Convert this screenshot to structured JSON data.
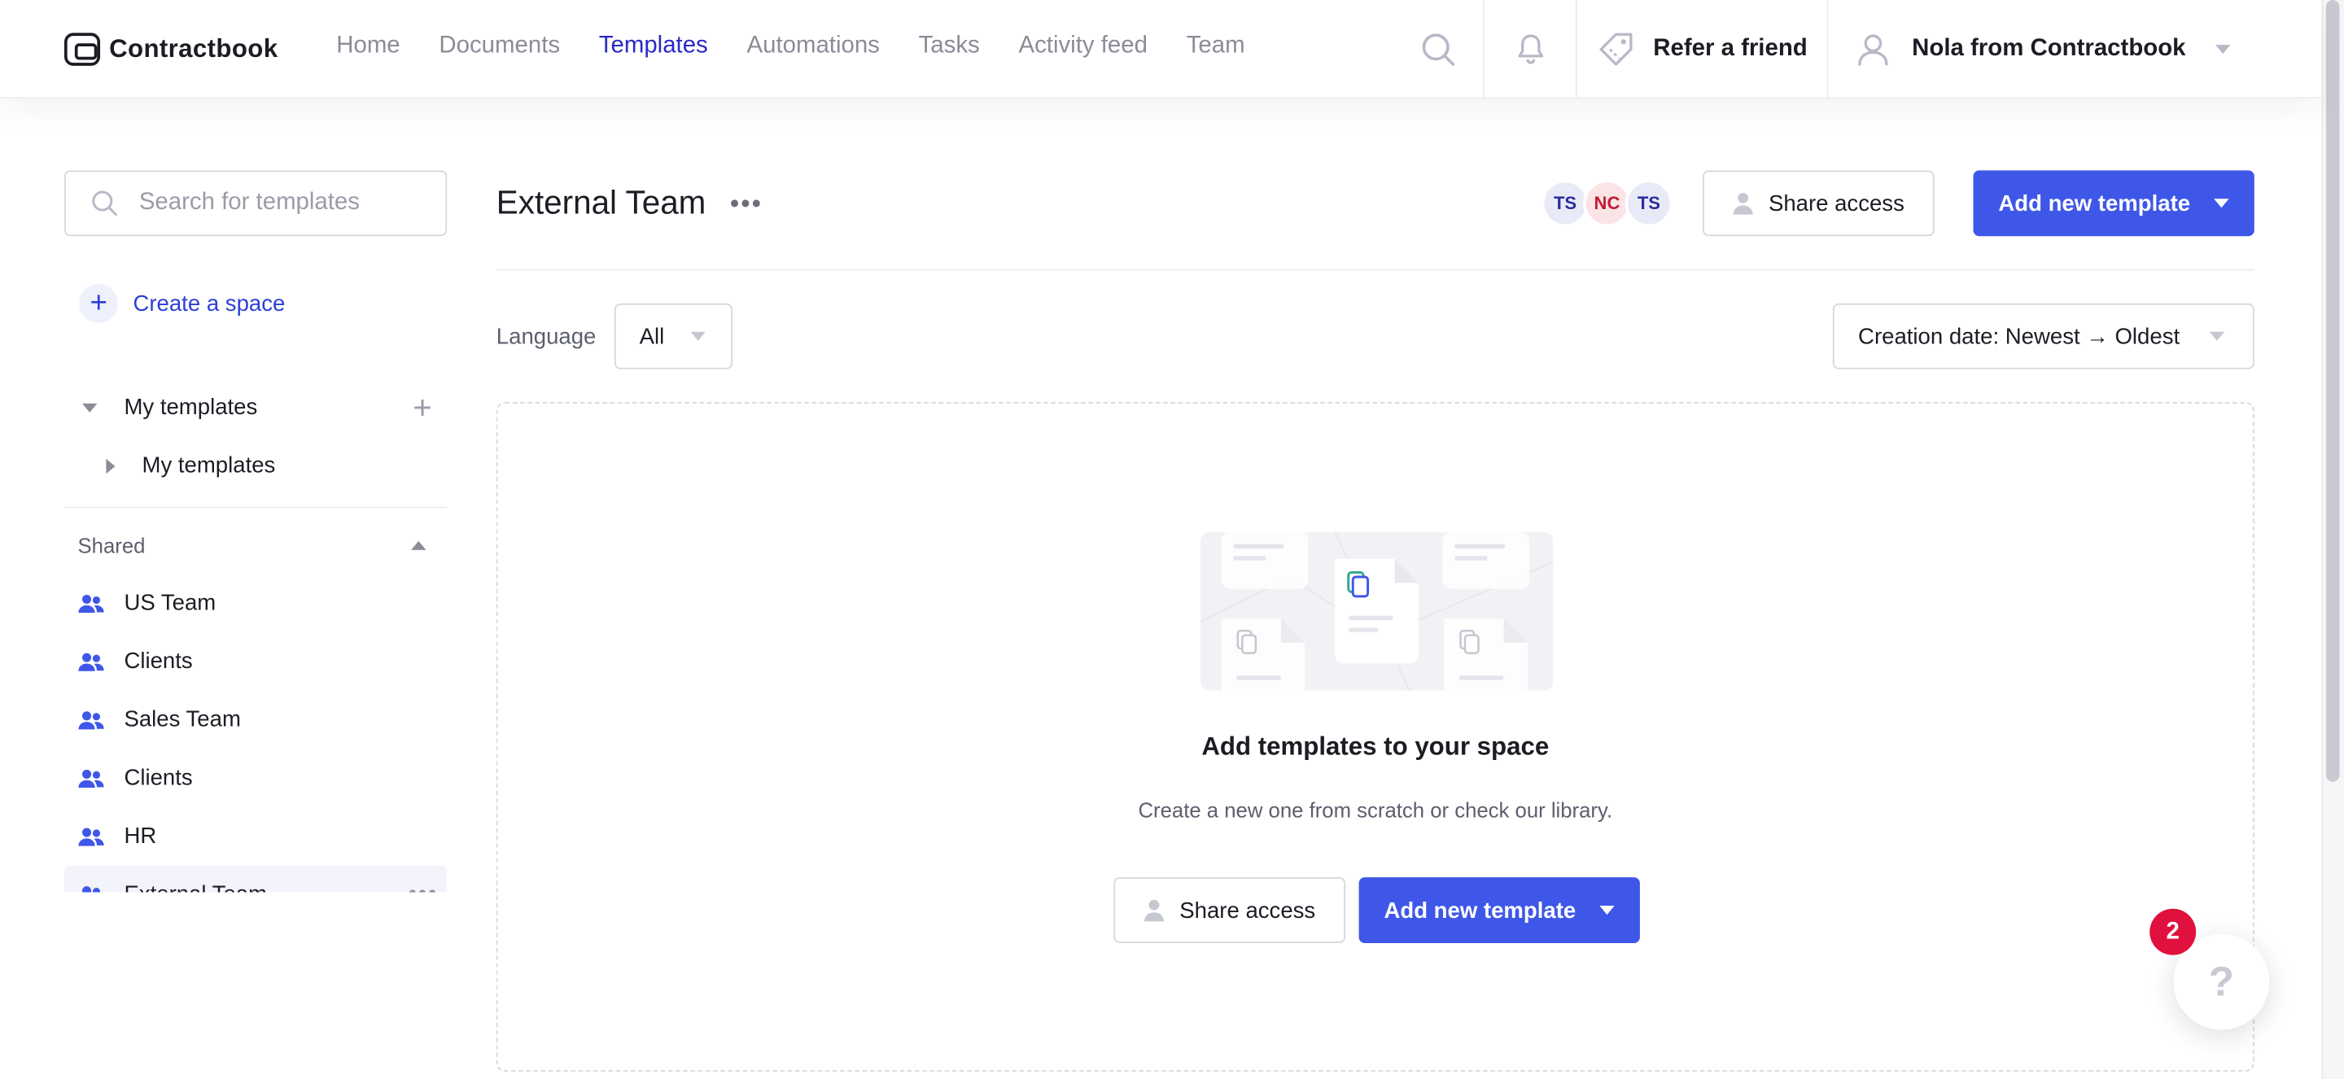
{
  "app": {
    "brand": "Contractbook"
  },
  "nav": {
    "items": [
      {
        "label": "Home",
        "active": false
      },
      {
        "label": "Documents",
        "active": false
      },
      {
        "label": "Templates",
        "active": true
      },
      {
        "label": "Automations",
        "active": false
      },
      {
        "label": "Tasks",
        "active": false
      },
      {
        "label": "Activity feed",
        "active": false
      },
      {
        "label": "Team",
        "active": false
      }
    ],
    "refer_label": "Refer a friend",
    "user_label": "Nola from Contractbook"
  },
  "sidebar": {
    "search_placeholder": "Search for templates",
    "create_space_label": "Create a space",
    "my_templates_heading": "My templates",
    "my_templates_child": "My templates",
    "shared_heading": "Shared",
    "teams": [
      "US Team",
      "Clients",
      "Sales Team",
      "Clients",
      "HR",
      "External Team"
    ],
    "active_team": "External Team"
  },
  "main": {
    "title": "External Team",
    "avatars": [
      {
        "initials": "TS",
        "color": "#2a2c9a"
      },
      {
        "initials": "NC",
        "color": "#c21b35"
      },
      {
        "initials": "TS",
        "color": "#2a2c9a"
      }
    ],
    "share_label": "Share access",
    "add_label": "Add new template",
    "language_label": "Language",
    "language_value": "All",
    "sort_value": "Creation date: Newest → Oldest",
    "empty_title": "Add templates to your space",
    "empty_subtitle": "Create a new one from scratch or check our library."
  },
  "help": {
    "badge_count": "2",
    "glyph": "?"
  },
  "colors": {
    "accent": "#3f57e8",
    "nav_active": "#2a2bc4",
    "badge": "#e0113e"
  }
}
